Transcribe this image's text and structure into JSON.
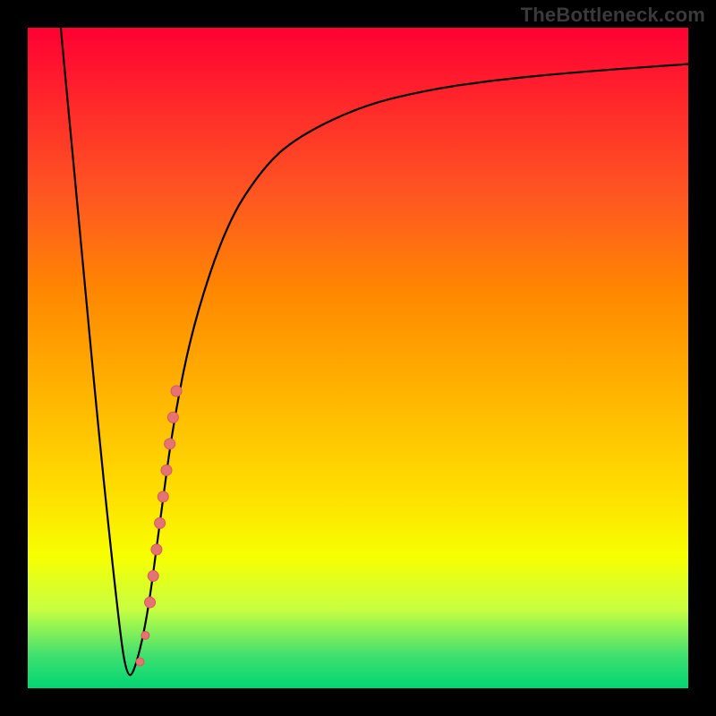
{
  "watermark": "TheBottleneck.com",
  "chart_data": {
    "type": "line",
    "title": "",
    "xlabel": "",
    "ylabel": "",
    "xlim": [
      0,
      100
    ],
    "ylim": [
      0,
      100
    ],
    "background_gradient": {
      "top": "#ff0033",
      "bottom": "#00d672"
    },
    "series": [
      {
        "name": "bottleneck-curve",
        "color": "#000000",
        "x": [
          5,
          8,
          11,
          14,
          15,
          16,
          18,
          20,
          22,
          25,
          30,
          35,
          40,
          50,
          60,
          70,
          80,
          90,
          100
        ],
        "values": [
          100,
          68,
          36,
          8,
          2,
          2,
          10,
          25,
          40,
          55,
          70,
          78,
          83,
          88,
          90.5,
          92,
          93,
          93.8,
          94.5
        ]
      }
    ],
    "highlight_points": {
      "name": "highlight-dots",
      "color": "#e57373",
      "stroke": "#d85a5a",
      "radius_large": 6,
      "radius_small": 4.5,
      "points": [
        {
          "x": 17.0,
          "y": 4.0,
          "r": "small"
        },
        {
          "x": 17.8,
          "y": 8.0,
          "r": "small"
        },
        {
          "x": 18.5,
          "y": 13.0,
          "r": "large"
        },
        {
          "x": 19.0,
          "y": 17.0,
          "r": "large"
        },
        {
          "x": 19.5,
          "y": 21.0,
          "r": "large"
        },
        {
          "x": 20.0,
          "y": 25.0,
          "r": "large"
        },
        {
          "x": 20.5,
          "y": 29.0,
          "r": "large"
        },
        {
          "x": 21.0,
          "y": 33.0,
          "r": "large"
        },
        {
          "x": 21.5,
          "y": 37.0,
          "r": "large"
        },
        {
          "x": 22.0,
          "y": 41.0,
          "r": "large"
        },
        {
          "x": 22.5,
          "y": 45.0,
          "r": "large"
        }
      ]
    }
  }
}
